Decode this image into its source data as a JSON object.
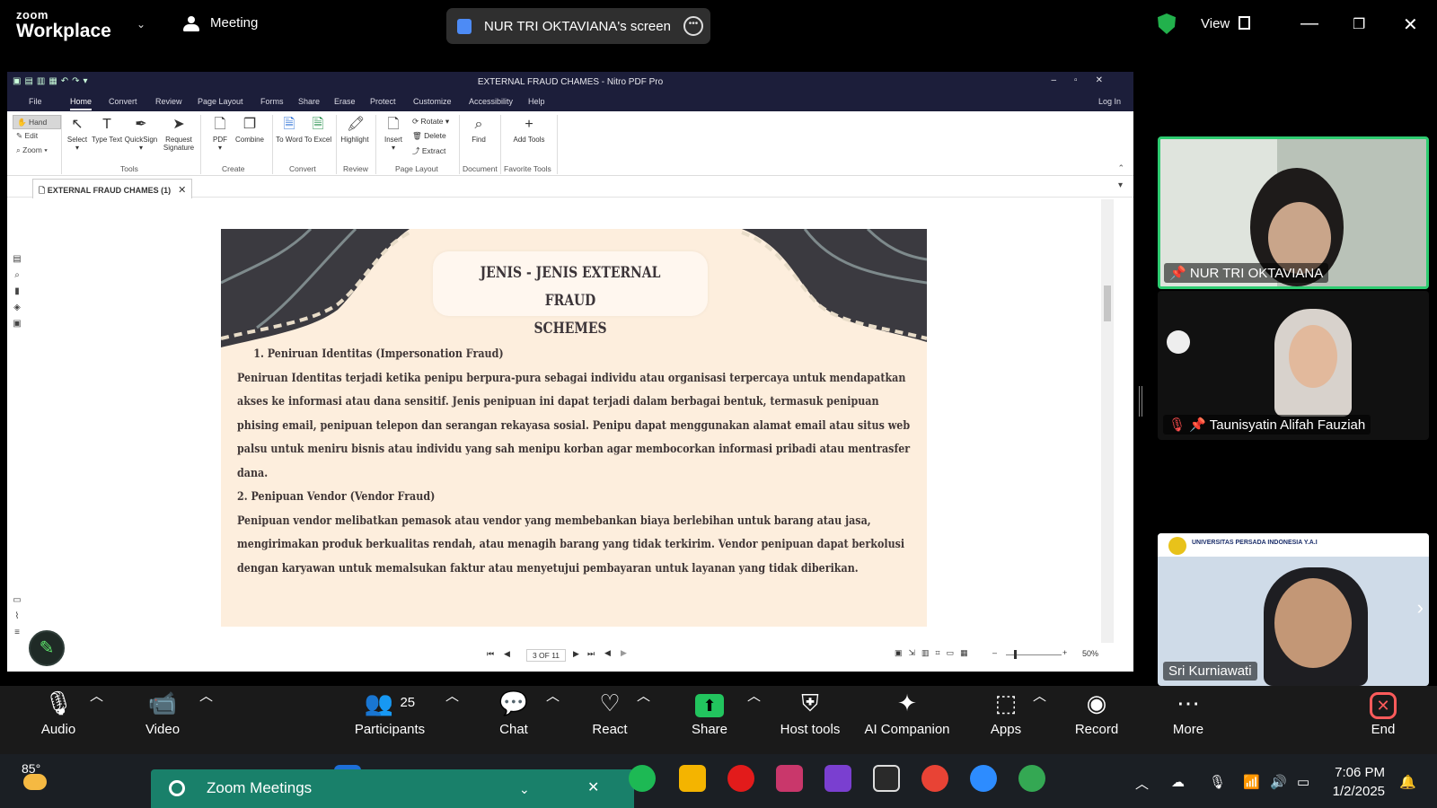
{
  "zoom": {
    "logo_top": "zoom",
    "logo_bottom": "Workplace",
    "meeting_label": "Meeting",
    "sharing_label": "NUR TRI OKTAVIANA's screen",
    "view_label": "View"
  },
  "nitro": {
    "window_title": "EXTERNAL FRAUD CHAMES - Nitro PDF Pro",
    "menu": [
      "File",
      "Home",
      "Convert",
      "Review",
      "Page Layout",
      "Forms",
      "Share",
      "Erase",
      "Protect",
      "Customize",
      "Accessibility",
      "Help"
    ],
    "login": "Log In",
    "left_tools": [
      "Hand",
      "Edit",
      "Zoom"
    ],
    "ribbon": {
      "select": "Select",
      "type_text": "Type Text",
      "quicksign": "QuickSign",
      "request_signature": "Request Signature",
      "pdf": "PDF",
      "combine": "Combine",
      "to_word": "To Word",
      "to_excel": "To Excel",
      "highlight": "Highlight",
      "insert": "Insert",
      "rotate": "Rotate",
      "delete": "Delete",
      "extract": "Extract",
      "find": "Find",
      "add_tools": "Add Tools"
    },
    "groups": [
      "Tools",
      "Create",
      "Convert",
      "Review",
      "Page Layout",
      "Document",
      "Favorite Tools"
    ],
    "doc_tab": "EXTERNAL FRAUD CHAMES (1)",
    "page_indicator": "3 OF 11",
    "zoom_level": "50%"
  },
  "slide": {
    "title_line1": "JENIS - JENIS EXTERNAL FRAUD",
    "title_line2": "SCHEMES",
    "lines": [
      "1. Peniruan Identitas (Impersonation Fraud)",
      "Peniruan Identitas terjadi ketika penipu berpura-pura sebagai individu atau organisasi terpercaya untuk  mendapatkan",
      "akses ke informasi atau dana sensitif. Jenis penipuan ini dapat terjadi dalam berbagai bentuk, termasuk penipuan",
      "phising email, penipuan telepon dan serangan rekayasa sosial. Penipu dapat menggunakan alamat email atau situs web",
      "palsu untuk meniru bisnis atau individu yang sah menipu korban agar membocorkan informasi pribadi atau mentrasfer",
      "dana.",
      "2. Penipuan Vendor (Vendor Fraud)",
      "Penipuan vendor melibatkan pemasok atau vendor yang membebankan biaya berlebihan untuk barang atau jasa,",
      "mengirimakan produk berkualitas  rendah, atau menagih barang yang tidak  terkirim. Vendor penipuan dapat berkolusi",
      "dengan karyawan untuk memalsukan faktur  atau menyetujui pembayaran untuk layanan yang tidak diberikan."
    ]
  },
  "participants": {
    "tile1": "NUR TRI OKTAVIANA",
    "tile2": "Taunisyatin Alifah Fauziah",
    "tile3": "Sri Kurniawati",
    "tile3_banner": "UNIVERSITAS PERSADA INDONESIA Y.A.I"
  },
  "toolbar": {
    "audio": "Audio",
    "video": "Video",
    "participants": "Participants",
    "participants_count": "25",
    "chat": "Chat",
    "react": "React",
    "share": "Share",
    "host_tools": "Host tools",
    "ai_companion": "AI Companion",
    "apps": "Apps",
    "record": "Record",
    "more": "More",
    "end": "End"
  },
  "taskbar": {
    "temperature": "85°",
    "popup_label": "Zoom Meetings",
    "time": "7:06 PM",
    "date": "1/2/2025"
  },
  "colors": {
    "share_green": "#22c45e",
    "end_red": "#ff5b5b",
    "active_speaker": "#2ecc71",
    "slide_bg": "#fdeedd",
    "slide_band": "#3b3a40"
  }
}
